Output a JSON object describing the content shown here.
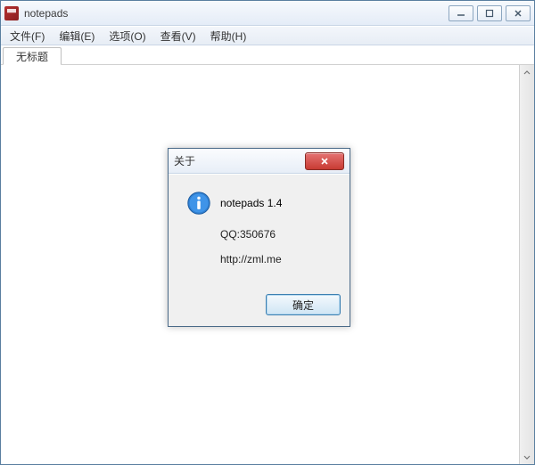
{
  "window": {
    "title": "notepads"
  },
  "menubar": {
    "items": [
      {
        "label": "文件(F)"
      },
      {
        "label": "编辑(E)"
      },
      {
        "label": "选项(O)"
      },
      {
        "label": "查看(V)"
      },
      {
        "label": "帮助(H)"
      }
    ]
  },
  "tabs": [
    {
      "label": "无标题"
    }
  ],
  "editor": {
    "value": ""
  },
  "dialog": {
    "title": "关于",
    "line1": "notepads 1.4",
    "line2": "QQ:350676",
    "line3": "http://zml.me",
    "ok": "确定"
  }
}
